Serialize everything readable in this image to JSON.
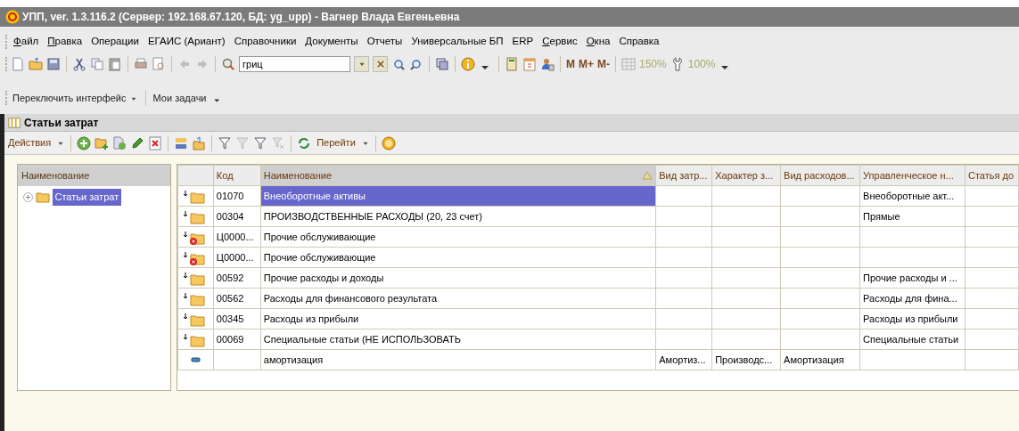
{
  "window": {
    "title": "УПП, ver. 1.3.116.2 (Сервер: 192.168.67.120, БД: yg_upp) - Вагнер Влада Евгеньевна"
  },
  "menu": [
    {
      "label": "Файл",
      "underline_first": true
    },
    {
      "label": "Правка",
      "underline_first": true
    },
    {
      "label": "Операции",
      "underline_first": false
    },
    {
      "label": "ЕГАИС (Ариант)",
      "underline_first": false
    },
    {
      "label": "Справочники",
      "underline_first": false
    },
    {
      "label": "Документы",
      "underline_first": false
    },
    {
      "label": "Отчеты",
      "underline_first": false
    },
    {
      "label": "Универсальные БП",
      "underline_first": false
    },
    {
      "label": "ERP",
      "underline_first": false
    },
    {
      "label": "Сервис",
      "underline_first": true
    },
    {
      "label": "Окна",
      "underline_first": true
    },
    {
      "label": "Справка",
      "underline_first": false
    }
  ],
  "toolbar": {
    "search_value": "гриц",
    "texts": [
      {
        "label": "M",
        "disabled": false
      },
      {
        "label": "M+",
        "disabled": false
      },
      {
        "label": "M-",
        "disabled": false
      },
      {
        "label": "150%",
        "disabled": true
      },
      {
        "label": "100%",
        "disabled": true
      }
    ]
  },
  "panel_bar": [
    {
      "label": "Переключить интерфейс",
      "dropdown": true
    },
    {
      "label": "Мои задачи",
      "dropdown": false
    }
  ],
  "form": {
    "title": "Статьи затрат",
    "actions_label": "Действия",
    "goto_label": "Перейти",
    "tree": {
      "header": "Наименование",
      "items": [
        {
          "label": "Статьи затрат",
          "selected": true,
          "expanded": false
        }
      ]
    },
    "table": {
      "columns": [
        "Код",
        "Наименование",
        "Вид затр...",
        "Характер з...",
        "Вид расходов...",
        "Управленческое н...",
        "Статья до"
      ],
      "rows": [
        {
          "kind": "folder",
          "selected": true,
          "cells": [
            "01070",
            "Внеоборотные активы",
            "",
            "",
            "",
            "Внеоборотные акт...",
            ""
          ]
        },
        {
          "kind": "folder",
          "selected": false,
          "cells": [
            "00304",
            "ПРОИЗВОДСТВЕННЫЕ РАСХОДЫ (20, 23 счет)",
            "",
            "",
            "",
            "Прямые",
            ""
          ]
        },
        {
          "kind": "folder-deleted",
          "selected": false,
          "cells": [
            "Ц0000...",
            "Прочие обслуживающие",
            "",
            "",
            "",
            "",
            ""
          ]
        },
        {
          "kind": "folder-deleted",
          "selected": false,
          "cells": [
            "Ц0000...",
            "Прочие обслуживающие",
            "",
            "",
            "",
            "",
            ""
          ]
        },
        {
          "kind": "folder",
          "selected": false,
          "cells": [
            "00592",
            "Прочие расходы и доходы",
            "",
            "",
            "",
            "Прочие расходы и ...",
            ""
          ]
        },
        {
          "kind": "folder",
          "selected": false,
          "cells": [
            "00562",
            "Расходы для финансового результата",
            "",
            "",
            "",
            "Расходы для фина...",
            ""
          ]
        },
        {
          "kind": "folder",
          "selected": false,
          "cells": [
            "00345",
            "Расходы из прибыли",
            "",
            "",
            "",
            "Расходы из прибыли",
            ""
          ]
        },
        {
          "kind": "folder",
          "selected": false,
          "cells": [
            "00069",
            "Специальные статьи (НЕ ИСПОЛЬЗОВАТЬ",
            "",
            "",
            "",
            "Специальные статьи",
            ""
          ]
        },
        {
          "kind": "item",
          "selected": false,
          "cells": [
            "",
            "амортизация",
            "Амортиз...",
            "Производс...",
            "Амортизация",
            "",
            ""
          ]
        }
      ]
    }
  }
}
